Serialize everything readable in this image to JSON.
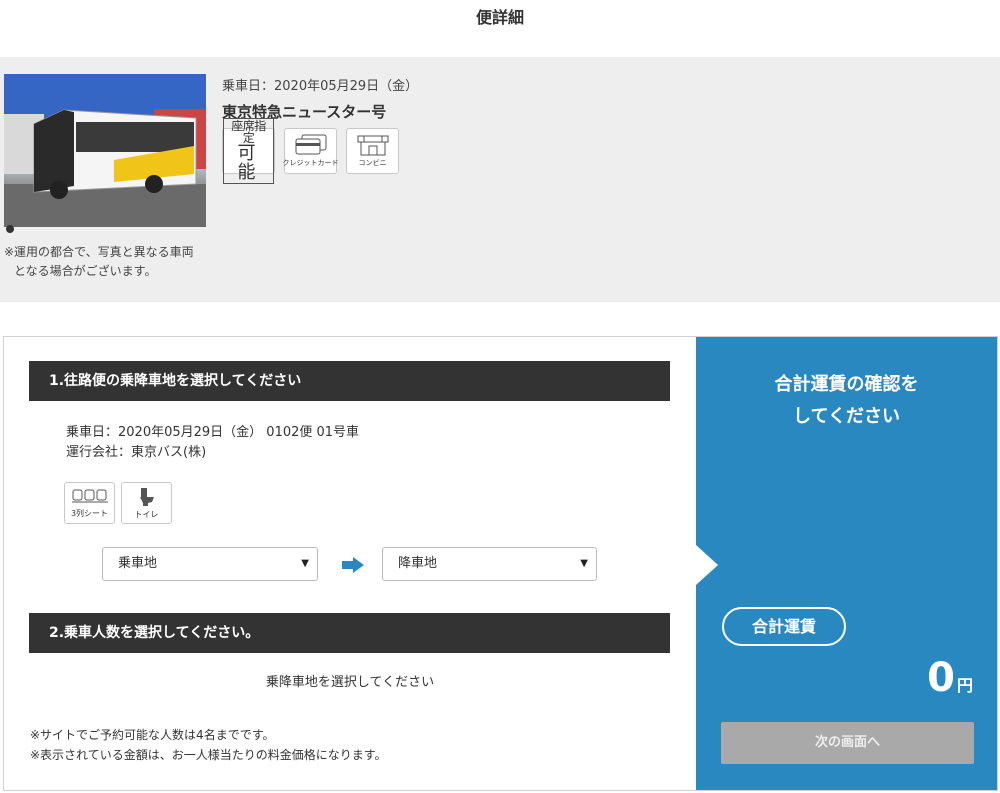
{
  "page": {
    "title": "便詳細"
  },
  "bus_info": {
    "photo_note_line1": "※運用の都合で、写真と異なる車両",
    "photo_note_line2": "となる場合がございます。",
    "ride_date": "乗車日：2020年05月29日（金）",
    "bus_name": "東京特急ニュースター号",
    "features": {
      "seat_reservation_line1": "座席指定",
      "seat_reservation_line2": "可 能",
      "credit_card": "クレジットカード",
      "convenience_store": "コンビニ"
    }
  },
  "section1": {
    "title": "1.往路便の乗降車地を選択してください",
    "ride_info": "乗車日：2020年05月29日（金） 0102便 01号車",
    "operator": "運行会社：東京バス(株)",
    "facilities": {
      "three_row_seat": "3列シート",
      "toilet": "トイレ"
    },
    "boarding_select": "乗車地",
    "alighting_select": "降車地"
  },
  "section2": {
    "title": "2.乗車人数を選択してください。",
    "guide": "乗降車地を選択してください",
    "note1": "※サイトでご予約可能な人数は4名までです。",
    "note2": "※表示されている金額は、お一人様当たりの料金価格になります。"
  },
  "summary": {
    "title_line1": "合計運賃の確認を",
    "title_line2": "してください",
    "total_label": "合計運賃",
    "total_amount": "0",
    "currency": "円",
    "next_button": "次の画面へ"
  },
  "colors": {
    "accent_blue": "#2a88c0",
    "section_bar": "#333333",
    "disabled_button": "#a9a9a9"
  }
}
